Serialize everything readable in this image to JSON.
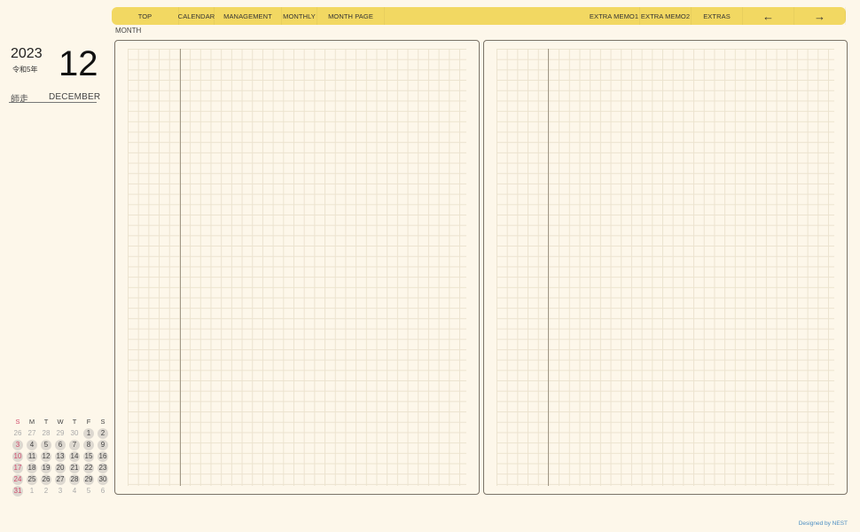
{
  "nav": {
    "left_items": [
      "TOP",
      "CALENDAR",
      "MANAGEMENT",
      "MONTHLY",
      "MONTH PAGE"
    ],
    "right_items": [
      "EXTRA MEMO1",
      "EXTRA MEMO2",
      "EXTRAS"
    ],
    "prev_arrow": "←",
    "next_arrow": "→"
  },
  "header": {
    "section_label": "MONTH",
    "year": "2023",
    "era": "令和5年",
    "month_number": "12",
    "month_jp": "師走",
    "month_en": "DECEMBER"
  },
  "mini_calendar": {
    "weekdays": [
      "S",
      "M",
      "T",
      "W",
      "T",
      "F",
      "S"
    ],
    "weeks": [
      [
        "26",
        "27",
        "28",
        "29",
        "30",
        "1",
        "2"
      ],
      [
        "3",
        "4",
        "5",
        "6",
        "7",
        "8",
        "9"
      ],
      [
        "10",
        "11",
        "12",
        "13",
        "14",
        "15",
        "16"
      ],
      [
        "17",
        "18",
        "19",
        "20",
        "21",
        "22",
        "23"
      ],
      [
        "24",
        "25",
        "26",
        "27",
        "28",
        "29",
        "30"
      ],
      [
        "31",
        "1",
        "2",
        "3",
        "4",
        "5",
        "6"
      ]
    ]
  },
  "footer": {
    "credit": "Designed by NEST"
  }
}
